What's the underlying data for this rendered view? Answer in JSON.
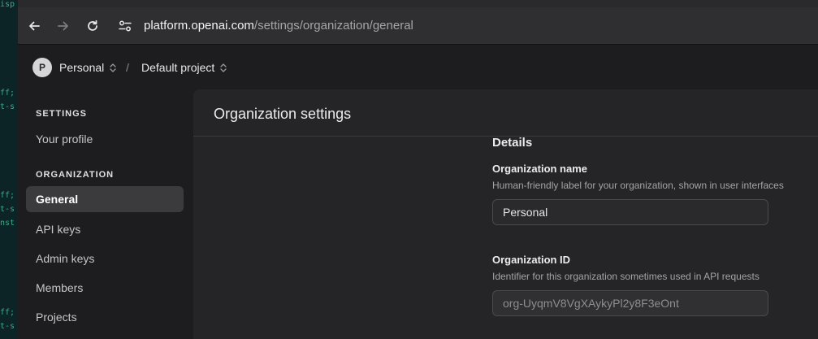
{
  "editor": {
    "lines": [
      {
        "text": "isp"
      },
      {
        "text": "ff;"
      },
      {
        "text": "t-s"
      },
      {
        "text": "ff;"
      },
      {
        "text": "t-s"
      },
      {
        "text": "nst"
      },
      {
        "text": "ff;"
      },
      {
        "text": "t-s"
      }
    ]
  },
  "browser": {
    "url_host": "platform.openai.com",
    "url_path": "/settings/organization/general"
  },
  "header": {
    "avatar_letter": "P",
    "org_label": "Personal",
    "separator": "/",
    "project_label": "Default project"
  },
  "sidebar": {
    "settings_heading": "SETTINGS",
    "your_profile": "Your profile",
    "organization_heading": "ORGANIZATION",
    "items": [
      {
        "label": "General",
        "active": true
      },
      {
        "label": "API keys"
      },
      {
        "label": "Admin keys"
      },
      {
        "label": "Members"
      },
      {
        "label": "Projects"
      }
    ]
  },
  "main": {
    "title": "Organization settings",
    "details_heading": "Details",
    "org_name": {
      "label": "Organization name",
      "help": "Human-friendly label for your organization, shown in user interfaces",
      "value": "Personal"
    },
    "org_id": {
      "label": "Organization ID",
      "help": "Identifier for this organization sometimes used in API requests",
      "value": "org-UyqmV8VgXAykyPl2y8F3eOnt"
    }
  }
}
